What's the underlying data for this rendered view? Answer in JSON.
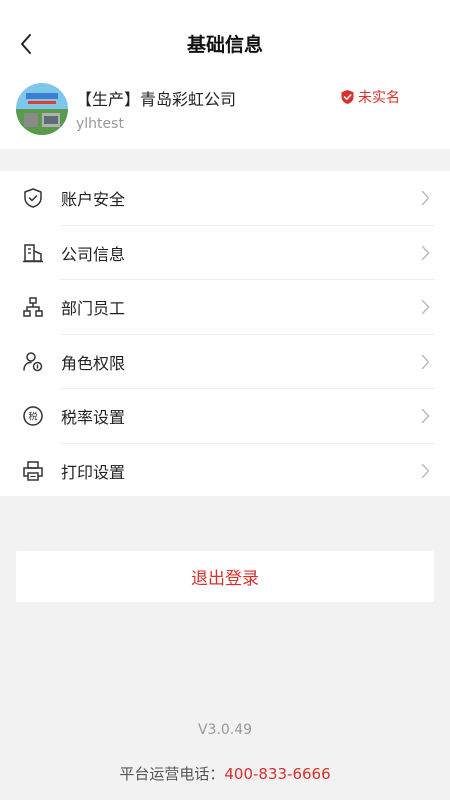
{
  "header": {
    "title": "基础信息",
    "back_icon": "chevron-left-icon"
  },
  "profile": {
    "company_name": "【生产】青岛彩虹公司",
    "user_id": "ylhtest",
    "verify_status": "未实名",
    "verify_color": "#d8302b"
  },
  "menu": {
    "items": [
      {
        "label": "账户安全",
        "icon": "shield-icon"
      },
      {
        "label": "公司信息",
        "icon": "building-icon"
      },
      {
        "label": "部门员工",
        "icon": "org-chart-icon"
      },
      {
        "label": "角色权限",
        "icon": "user-key-icon"
      },
      {
        "label": "税率设置",
        "icon": "tax-icon"
      },
      {
        "label": "打印设置",
        "icon": "printer-icon"
      }
    ]
  },
  "logout": {
    "label": "退出登录"
  },
  "footer": {
    "version": "V3.0.49",
    "hotline_label": "平台运营电话：",
    "hotline_number": "400-833-6666"
  },
  "colors": {
    "accent": "#d8302b",
    "background": "#f2f2f2"
  }
}
